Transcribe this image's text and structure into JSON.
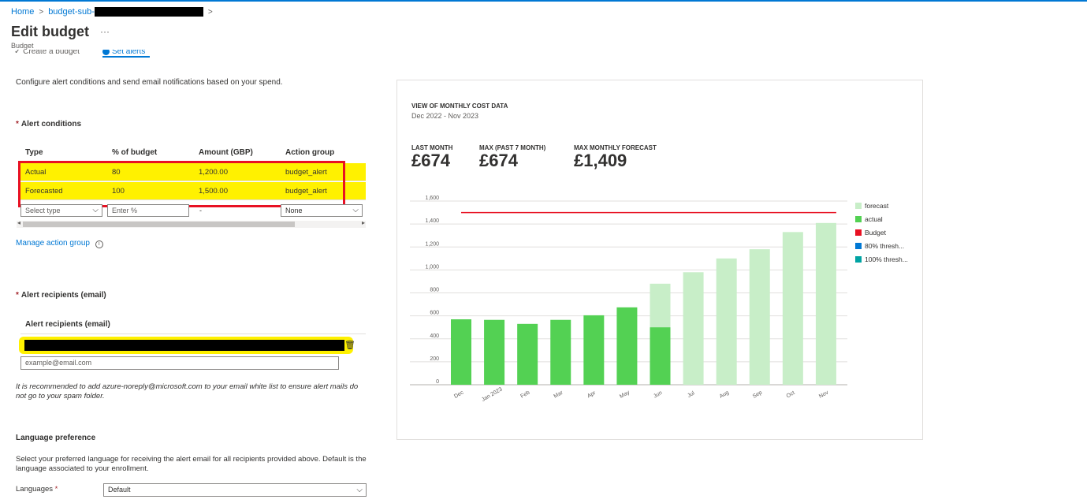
{
  "breadcrumb": {
    "home": "Home",
    "current": "budget-sub-"
  },
  "page": {
    "title": "Edit budget",
    "more": "···",
    "subtitle": "Budget"
  },
  "steps": [
    {
      "label": "Create a budget"
    },
    {
      "label": "Set alerts"
    }
  ],
  "description": "Configure alert conditions and send email notifications based on your spend.",
  "alert_conditions": {
    "heading": "Alert conditions",
    "columns": [
      "Type",
      "% of budget",
      "Amount (GBP)",
      "Action group"
    ],
    "rows": [
      {
        "type": "Actual",
        "percent": "80",
        "amount": "1,200.00",
        "action_group": "budget_alert"
      },
      {
        "type": "Forecasted",
        "percent": "100",
        "amount": "1,500.00",
        "action_group": "budget_alert"
      }
    ],
    "new_row": {
      "type_placeholder": "Select type",
      "percent_placeholder": "Enter %",
      "amount": "-",
      "action_group": "None"
    },
    "manage_link": "Manage action group"
  },
  "recipients": {
    "heading": "Alert recipients (email)",
    "column": "Alert recipients (email)",
    "placeholder": "example@email.com",
    "note": "It is recommended to add azure-noreply@microsoft.com to your email white list to ensure alert mails do not go to your spam folder."
  },
  "language": {
    "heading": "Language preference",
    "description": "Select your preferred language for receiving the alert email for all recipients provided above. Default is the language associated to your enrollment.",
    "label": "Languages",
    "value": "Default"
  },
  "cost_panel": {
    "title": "VIEW OF MONTHLY COST DATA",
    "range": "Dec 2022 - Nov 2023",
    "kpis": [
      {
        "label": "LAST MONTH",
        "value": "£674"
      },
      {
        "label": "MAX (PAST 7 MONTH)",
        "value": "£674"
      },
      {
        "label": "MAX MONTHLY FORECAST",
        "value": "£1,409"
      }
    ]
  },
  "colors": {
    "actual": "#53d153",
    "forecast": "#c8eec8",
    "budget": "#e81123",
    "thresh80": "#0078d4",
    "thresh100": "#00a3a3",
    "accent": "#0078d4",
    "highlight": "#fff100"
  },
  "chart_data": {
    "type": "bar",
    "categories": [
      "Dec",
      "Jan 2023",
      "Feb",
      "Mar",
      "Apr",
      "May",
      "Jun",
      "Jul",
      "Aug",
      "Sep",
      "Oct",
      "Nov"
    ],
    "series": [
      {
        "name": "forecast",
        "values": [
          null,
          null,
          null,
          null,
          null,
          null,
          880,
          980,
          1100,
          1180,
          1330,
          1409
        ]
      },
      {
        "name": "actual",
        "values": [
          570,
          565,
          530,
          565,
          605,
          674,
          500,
          null,
          null,
          null,
          null,
          null
        ]
      },
      {
        "name": "Budget",
        "type": "line",
        "values": [
          1500,
          1500,
          1500,
          1500,
          1500,
          1500,
          1500,
          1500,
          1500,
          1500,
          1500,
          1500
        ]
      },
      {
        "name": "80% thresh..."
      },
      {
        "name": "100% thresh..."
      }
    ],
    "yticks": [
      0,
      200,
      400,
      600,
      800,
      1000,
      1200,
      1400,
      1600
    ],
    "ytick_labels": [
      "0",
      "200",
      "400",
      "600",
      "800",
      "1,000",
      "1,200",
      "1,400",
      "1,600"
    ],
    "ylim": [
      0,
      1600
    ],
    "grid": true,
    "legend_position": "right"
  }
}
